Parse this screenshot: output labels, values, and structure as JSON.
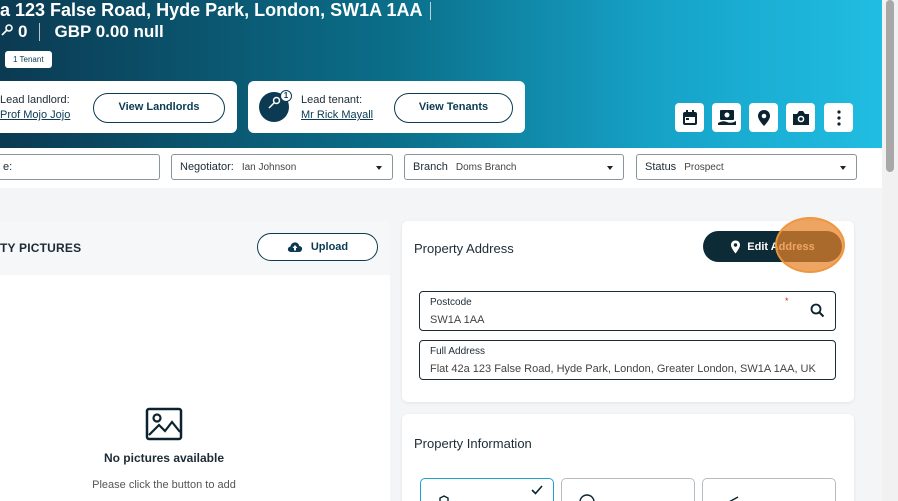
{
  "header": {
    "address": "a 123 False Road, Hyde Park, London, SW1A 1AA",
    "key_count": "0",
    "price": "GBP 0.00 null",
    "tenant_badge": "1 Tenant",
    "lead_landlord_label": "Lead landlord:",
    "lead_landlord_name": "Prof Mojo Jojo",
    "view_landlords_label": "View Landlords",
    "lead_tenant_label": "Lead tenant:",
    "lead_tenant_name": "Mr Rick Mayall",
    "tenant_count_badge": "1",
    "view_tenants_label": "View Tenants"
  },
  "toolbar": {
    "icons": [
      "calendar-icon",
      "handshake-icon",
      "map-pin-icon",
      "camera-icon",
      "more-vertical-icon"
    ]
  },
  "filters": {
    "partial_label": "e:",
    "negotiator_label": "Negotiator:",
    "negotiator_value": "Ian Johnson",
    "branch_label": "Branch",
    "branch_value": "Doms Branch",
    "status_label": "Status",
    "status_value": "Prospect"
  },
  "pictures": {
    "title": "TY PICTURES",
    "upload_label": "Upload",
    "empty_title": "No pictures available",
    "empty_sub": "Please click the button to add"
  },
  "address": {
    "title": "Property Address",
    "edit_label": "Edit Address",
    "postcode_label": "Postcode",
    "postcode_required": "*",
    "postcode_value": "SW1A 1AA",
    "full_label": "Full Address",
    "full_value": "Flat 42a 123 False Road, Hyde Park, London, Greater London, SW1A 1AA, UK"
  },
  "info": {
    "title": "Property Information"
  },
  "colors": {
    "brand_dark": "#0b3a52",
    "accent": "#21bde2",
    "button_dark": "#0d2b36",
    "highlight": "#e88228"
  }
}
